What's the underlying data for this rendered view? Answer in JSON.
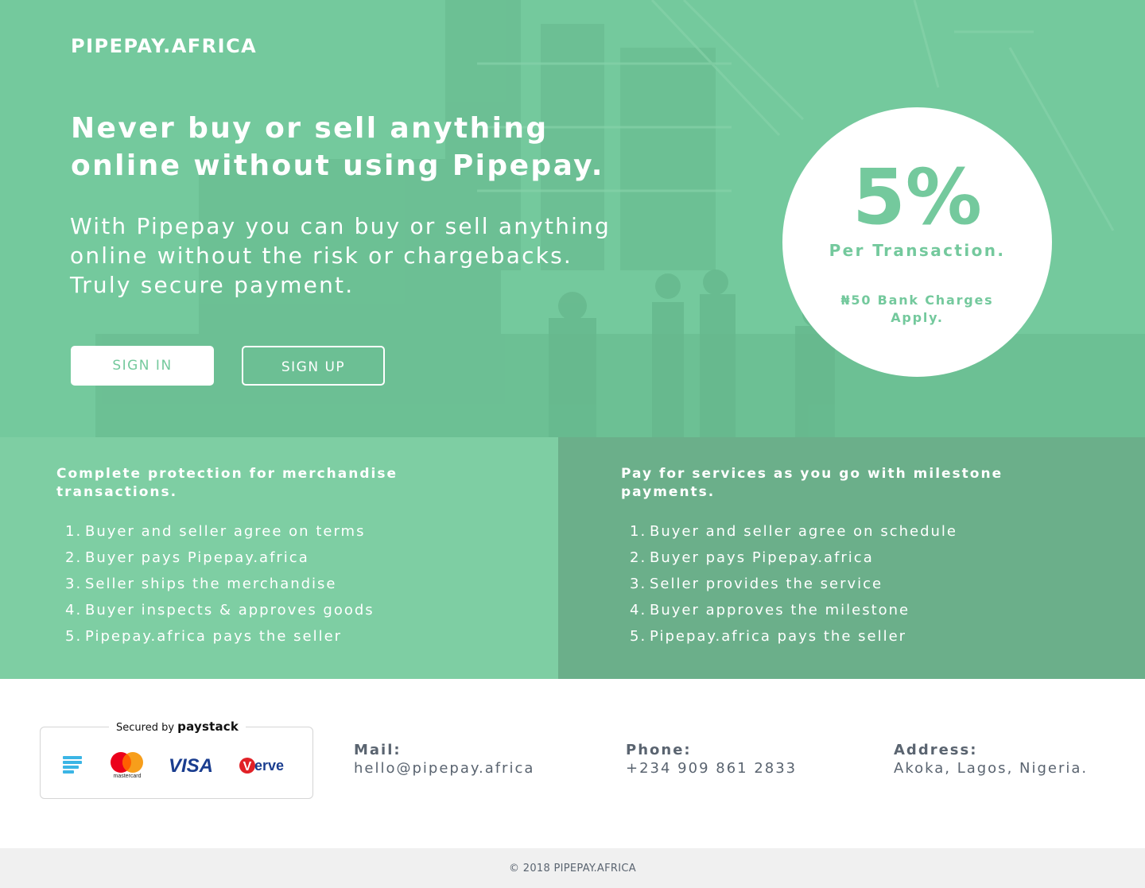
{
  "hero": {
    "brand": "PIPEPAY.AFRICA",
    "headline": "Never buy or sell anything online without using Pipepay.",
    "lead": "With Pipepay you can buy or sell anything online without the risk or chargebacks. Truly secure payment.",
    "signin_label": "SIGN IN",
    "signup_label": "SIGN UP",
    "rate": {
      "percent": "5%",
      "per_transaction": "Per Transaction.",
      "bank_charges": "₦50 Bank Charges Apply."
    }
  },
  "features": {
    "merchandise": {
      "title": "Complete protection for merchandise transactions.",
      "steps": [
        {
          "num": "1.",
          "text": "Buyer and seller agree on terms"
        },
        {
          "num": "2.",
          "text": "Buyer pays Pipepay.africa"
        },
        {
          "num": "3.",
          "text": "Seller ships the merchandise"
        },
        {
          "num": "4.",
          "text": "Buyer inspects & approves goods"
        },
        {
          "num": "5.",
          "text": "Pipepay.africa pays the seller"
        }
      ]
    },
    "services": {
      "title": "Pay for services as you go with milestone payments.",
      "steps": [
        {
          "num": "1.",
          "text": "Buyer and seller agree on schedule"
        },
        {
          "num": "2.",
          "text": "Buyer pays Pipepay.africa"
        },
        {
          "num": "3.",
          "text": "Seller provides the service"
        },
        {
          "num": "4.",
          "text": "Buyer approves the milestone"
        },
        {
          "num": "5.",
          "text": "Pipepay.africa pays the seller"
        }
      ]
    }
  },
  "paystack": {
    "secured_by": "Secured by",
    "brand": "paystack",
    "logos": [
      "paystack-icon",
      "mastercard-icon",
      "visa-icon",
      "verve-icon"
    ],
    "mastercard_caption": "mastercard",
    "visa_text": "VISA",
    "verve_text": "erve",
    "verve_v": "V"
  },
  "contact": {
    "mail_label": "Mail:",
    "mail_value": "hello@pipepay.africa",
    "phone_label": "Phone:",
    "phone_value": "+234 909 861 2833",
    "address_label": "Address:",
    "address_value": "Akoka, Lagos, Nigeria."
  },
  "footer": {
    "copyright": "© 2018 PIPEPAY.AFRICA"
  },
  "colors": {
    "hero_green": "#74c99d",
    "left_panel": "#7ecea3",
    "right_panel": "#6baf8a",
    "contact_text": "#5a6470",
    "copyright_bg": "#f0f0f0"
  }
}
